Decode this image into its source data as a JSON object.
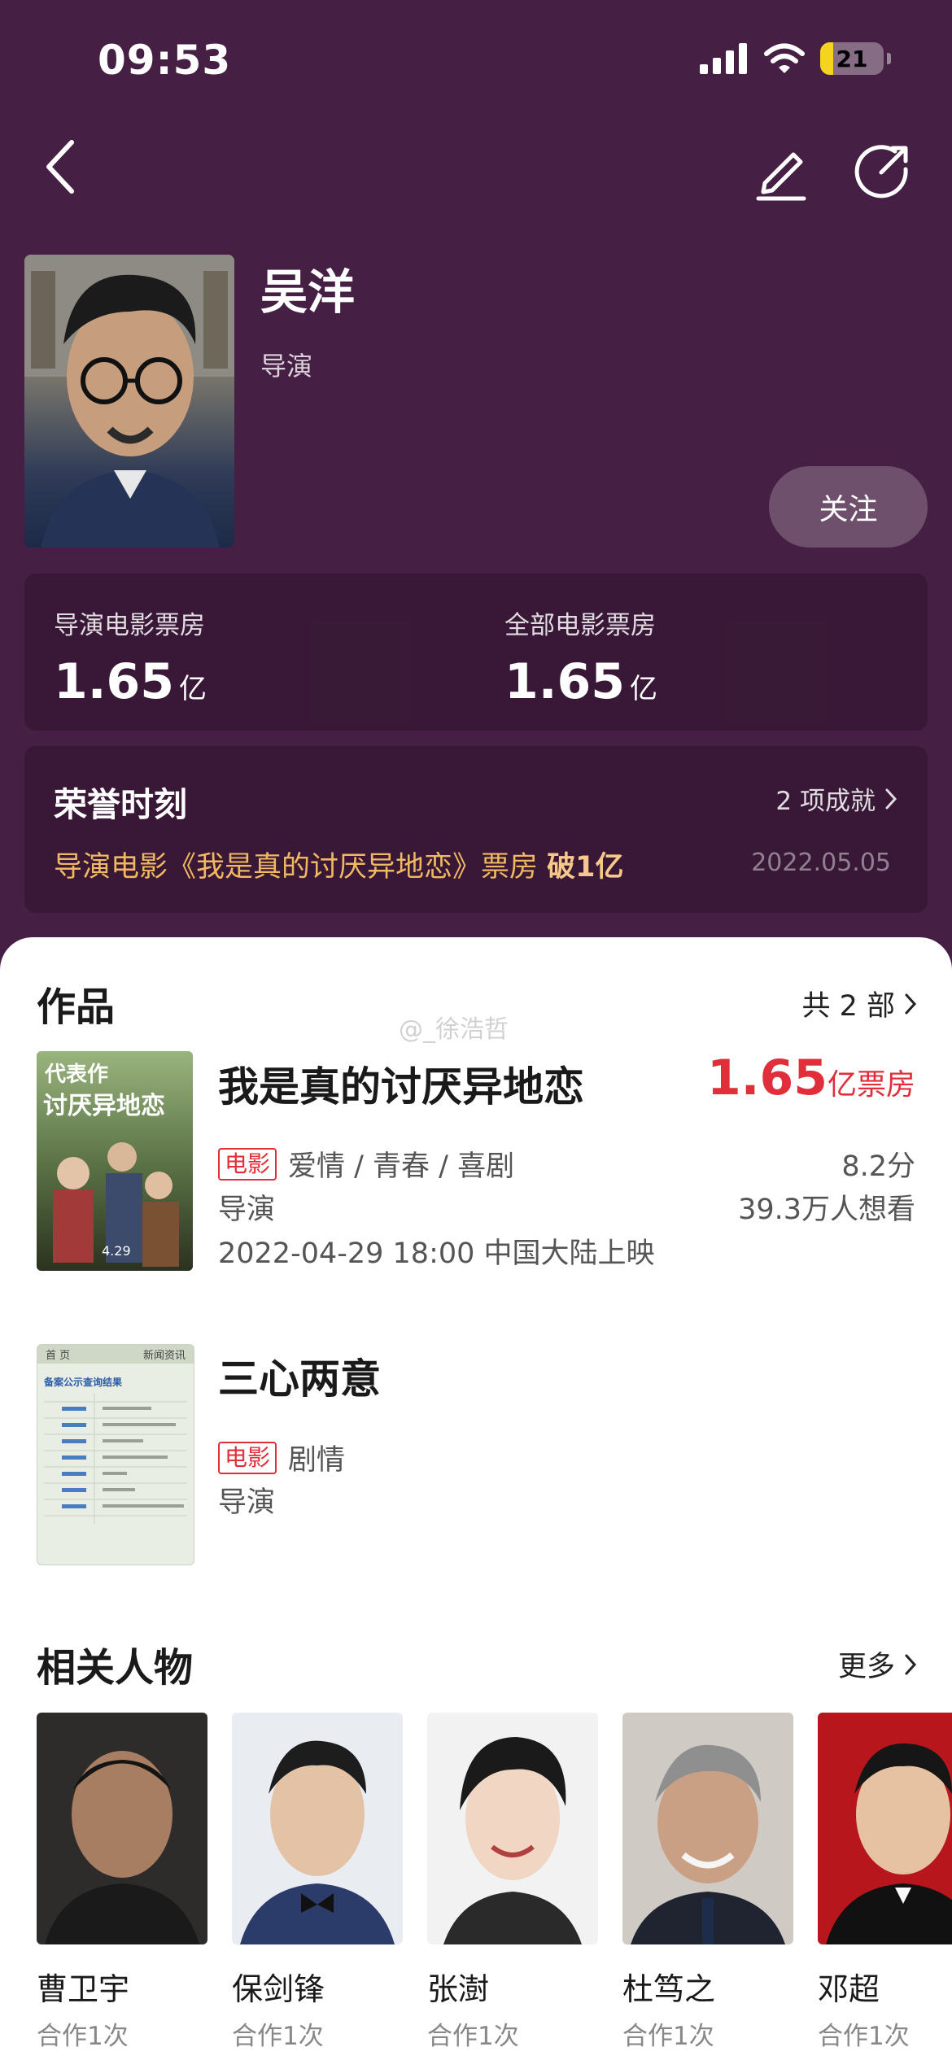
{
  "status_bar": {
    "time": "09:53",
    "battery": "21",
    "battery_level": 0.21
  },
  "profile": {
    "name": "吴洋",
    "role": "导演",
    "follow_label": "关注"
  },
  "box_office": {
    "director_label": "导演电影票房",
    "director_value": "1.65",
    "director_unit": "亿",
    "all_label": "全部电影票房",
    "all_value": "1.65",
    "all_unit": "亿"
  },
  "honors": {
    "title": "荣誉时刻",
    "count": "2 项成就",
    "text": "导演电影《我是真的讨厌异地恋》票房",
    "text_bold": "破1亿",
    "date": "2022.05.05"
  },
  "works": {
    "title": "作品",
    "count": "共 2 部",
    "watermark": "@_徐浩哲",
    "items": [
      {
        "badge": "代表作",
        "title": "我是真的讨厌异地恋",
        "box_value": "1.65",
        "box_unit": "亿票房",
        "tag": "电影",
        "genre": "爱情 / 青春 / 喜剧",
        "role": "导演",
        "release": "2022-04-29 18:00 中国大陆上映",
        "score": "8.2分",
        "want": "39.3万人想看",
        "poster_title": "讨厌异地恋",
        "poster_date": "4.29"
      },
      {
        "title": "三心两意",
        "tag": "电影",
        "genre": "剧情",
        "role": "导演",
        "poster_tab1": "首 页",
        "poster_tab2": "新闻资讯",
        "poster_heading": "备案公示查询结果"
      }
    ]
  },
  "related": {
    "title": "相关人物",
    "more": "更多",
    "people": [
      {
        "name": "曹卫宇",
        "sub": "合作1次"
      },
      {
        "name": "保剑锋",
        "sub": "合作1次"
      },
      {
        "name": "张澍",
        "sub": "合作1次"
      },
      {
        "name": "杜笃之",
        "sub": "合作1次"
      },
      {
        "name": "邓超",
        "sub": "合作1次"
      }
    ]
  }
}
